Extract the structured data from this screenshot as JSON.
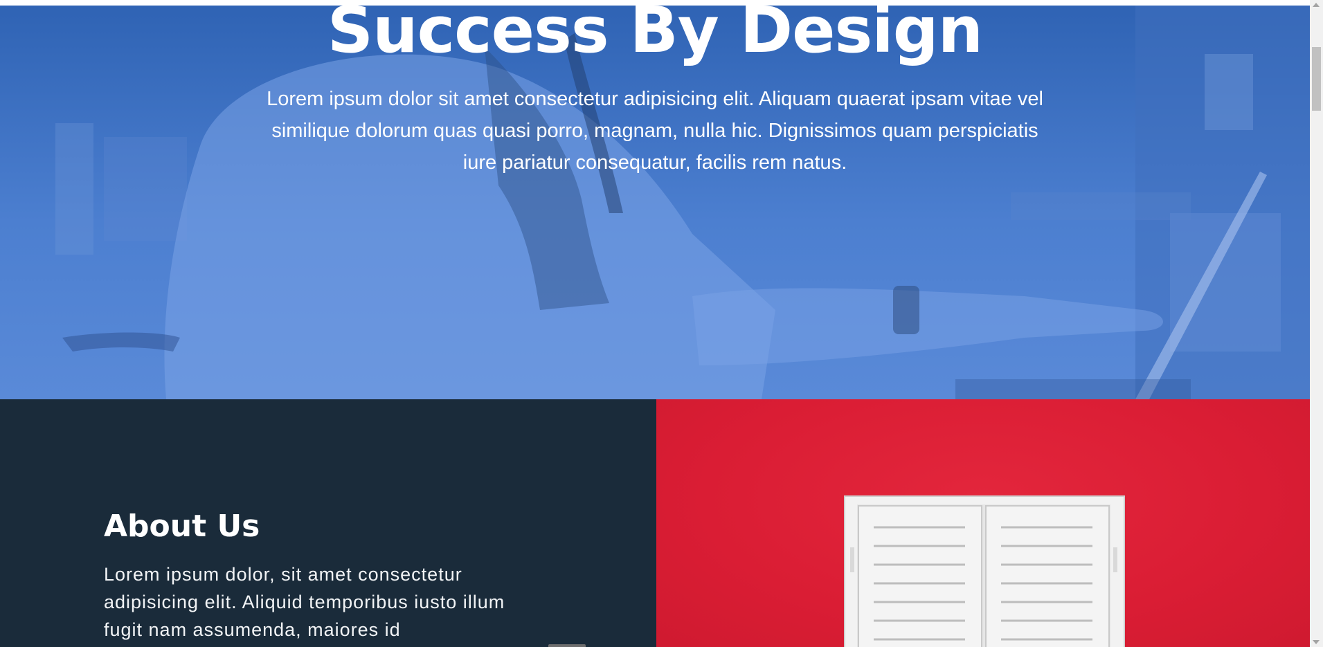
{
  "hero": {
    "title": "Success By Design",
    "description": "Lorem ipsum dolor sit amet consectetur adipisicing elit. Aliquam quaerat ipsam vitae vel similique dolorum quas quasi porro, magnam, nulla hic. Dignissimos quam perspiciatis iure pariatur consequatur, facilis rem natus.",
    "overlay_color": "#3a6ec2"
  },
  "about": {
    "title": "About Us",
    "text": "Lorem ipsum dolor, sit amet consectetur adipisicing elit. Aliquid temporibus iusto illum fugit nam assumenda, maiores id",
    "background_color": "#1a2b3a"
  },
  "feature_image": {
    "icon": "window-shutters-icon",
    "background_color": "#dc1f36"
  }
}
